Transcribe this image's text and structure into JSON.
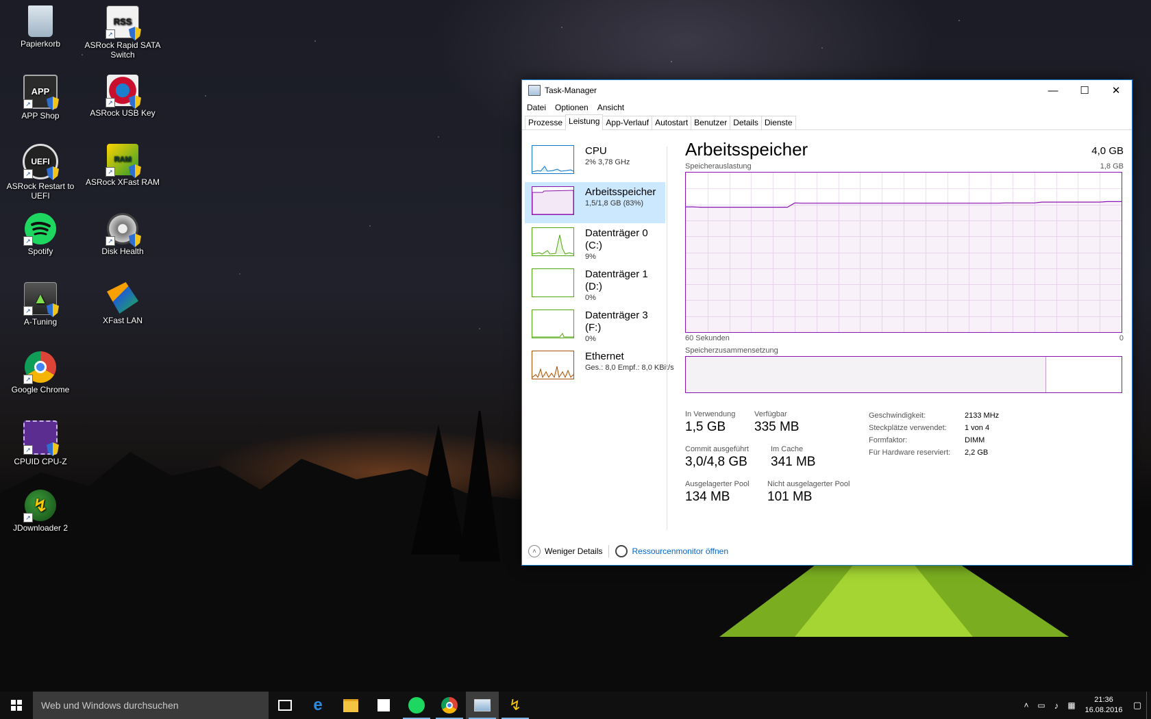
{
  "desktop": {
    "icons": [
      {
        "label": "Papierkorb"
      },
      {
        "label": "ASRock Rapid SATA Switch",
        "glyph": "RSS"
      },
      {
        "label": "APP Shop",
        "glyph": "APP"
      },
      {
        "label": "ASRock USB Key"
      },
      {
        "label": "ASRock Restart to UEFI",
        "glyph": "UEFI"
      },
      {
        "label": "ASRock XFast RAM",
        "glyph": "RAM"
      },
      {
        "label": "Spotify"
      },
      {
        "label": "Disk Health"
      },
      {
        "label": "A-Tuning"
      },
      {
        "label": "XFast LAN"
      },
      {
        "label": "Google Chrome"
      },
      {
        "label": "CPUID CPU-Z"
      },
      {
        "label": "JDownloader 2"
      }
    ]
  },
  "window": {
    "title": "Task-Manager",
    "controls": {
      "minimize": "—",
      "maximize": "☐",
      "close": "✕"
    },
    "menu": [
      "Datei",
      "Optionen",
      "Ansicht"
    ],
    "tabs": [
      "Prozesse",
      "Leistung",
      "App-Verlauf",
      "Autostart",
      "Benutzer",
      "Details",
      "Dienste"
    ],
    "active_tab": "Leistung"
  },
  "sidebar": {
    "items": [
      {
        "name": "CPU",
        "detail": "2%  3,78 GHz",
        "color": "#1176c8"
      },
      {
        "name": "Arbeitsspeicher",
        "detail": "1,5/1,8 GB (83%)",
        "color": "#8b12ae",
        "selected": true
      },
      {
        "name": "Datenträger 0 (C:)",
        "detail": "9%",
        "color": "#4da60c"
      },
      {
        "name": "Datenträger 1 (D:)",
        "detail": "0%",
        "color": "#4da60c"
      },
      {
        "name": "Datenträger 3 (F:)",
        "detail": "0%",
        "color": "#4da60c"
      },
      {
        "name": "Ethernet",
        "detail": "Ges.: 8,0  Empf.: 8,0 KBit/s",
        "color": "#a74f01"
      }
    ]
  },
  "main": {
    "title": "Arbeitsspeicher",
    "total": "4,0 GB",
    "usage_label": "Speicherauslastung",
    "usage_max": "1,8 GB",
    "time_left": "60 Sekunden",
    "time_right": "0",
    "composition_label": "Speicherzusammensetzung",
    "composition": {
      "in_use_fraction": 0.82,
      "modified_fraction": 0.006
    },
    "stats": {
      "in_use": {
        "label": "In Verwendung",
        "value": "1,5 GB"
      },
      "available": {
        "label": "Verfügbar",
        "value": "335 MB"
      },
      "committed": {
        "label": "Commit ausgeführt",
        "value": "3,0/4,8 GB"
      },
      "cached": {
        "label": "Im Cache",
        "value": "341 MB"
      },
      "paged_pool": {
        "label": "Ausgelagerter Pool",
        "value": "134 MB"
      },
      "nonpaged_pool": {
        "label": "Nicht ausgelagerter Pool",
        "value": "101 MB"
      }
    },
    "properties": [
      {
        "key": "Geschwindigkeit:",
        "value": "2133 MHz"
      },
      {
        "key": "Steckplätze verwendet:",
        "value": "1 von 4"
      },
      {
        "key": "Formfaktor:",
        "value": "DIMM"
      },
      {
        "key": "Für Hardware reserviert:",
        "value": "2,2 GB"
      }
    ],
    "usage_series": [
      0.785,
      0.785,
      0.783,
      0.783,
      0.783,
      0.783,
      0.783,
      0.783,
      0.783,
      0.783,
      0.783,
      0.783,
      0.783,
      0.783,
      0.783,
      0.81,
      0.808,
      0.808,
      0.808,
      0.808,
      0.808,
      0.808,
      0.808,
      0.808,
      0.808,
      0.808,
      0.808,
      0.808,
      0.808,
      0.808,
      0.808,
      0.808,
      0.808,
      0.808,
      0.808,
      0.808,
      0.808,
      0.808,
      0.808,
      0.808,
      0.808,
      0.808,
      0.808,
      0.808,
      0.81,
      0.81,
      0.81,
      0.81,
      0.81,
      0.815,
      0.815,
      0.815,
      0.815,
      0.815,
      0.815,
      0.815,
      0.815,
      0.815,
      0.818,
      0.818,
      0.818
    ]
  },
  "footer": {
    "fewer_details": "Weniger Details",
    "resource_monitor": "Ressourcenmonitor öffnen"
  },
  "taskbar": {
    "search_placeholder": "Web und Windows durchsuchen",
    "clock_time": "21:36",
    "clock_date": "16.08.2016"
  }
}
